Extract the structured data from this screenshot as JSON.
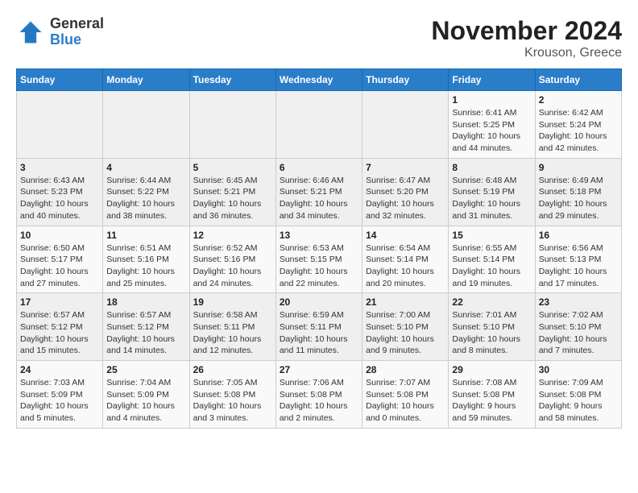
{
  "header": {
    "logo_line1": "General",
    "logo_line2": "Blue",
    "month": "November 2024",
    "location": "Krouson, Greece"
  },
  "weekdays": [
    "Sunday",
    "Monday",
    "Tuesday",
    "Wednesday",
    "Thursday",
    "Friday",
    "Saturday"
  ],
  "weeks": [
    [
      {
        "day": "",
        "info": ""
      },
      {
        "day": "",
        "info": ""
      },
      {
        "day": "",
        "info": ""
      },
      {
        "day": "",
        "info": ""
      },
      {
        "day": "",
        "info": ""
      },
      {
        "day": "1",
        "info": "Sunrise: 6:41 AM\nSunset: 5:25 PM\nDaylight: 10 hours\nand 44 minutes."
      },
      {
        "day": "2",
        "info": "Sunrise: 6:42 AM\nSunset: 5:24 PM\nDaylight: 10 hours\nand 42 minutes."
      }
    ],
    [
      {
        "day": "3",
        "info": "Sunrise: 6:43 AM\nSunset: 5:23 PM\nDaylight: 10 hours\nand 40 minutes."
      },
      {
        "day": "4",
        "info": "Sunrise: 6:44 AM\nSunset: 5:22 PM\nDaylight: 10 hours\nand 38 minutes."
      },
      {
        "day": "5",
        "info": "Sunrise: 6:45 AM\nSunset: 5:21 PM\nDaylight: 10 hours\nand 36 minutes."
      },
      {
        "day": "6",
        "info": "Sunrise: 6:46 AM\nSunset: 5:21 PM\nDaylight: 10 hours\nand 34 minutes."
      },
      {
        "day": "7",
        "info": "Sunrise: 6:47 AM\nSunset: 5:20 PM\nDaylight: 10 hours\nand 32 minutes."
      },
      {
        "day": "8",
        "info": "Sunrise: 6:48 AM\nSunset: 5:19 PM\nDaylight: 10 hours\nand 31 minutes."
      },
      {
        "day": "9",
        "info": "Sunrise: 6:49 AM\nSunset: 5:18 PM\nDaylight: 10 hours\nand 29 minutes."
      }
    ],
    [
      {
        "day": "10",
        "info": "Sunrise: 6:50 AM\nSunset: 5:17 PM\nDaylight: 10 hours\nand 27 minutes."
      },
      {
        "day": "11",
        "info": "Sunrise: 6:51 AM\nSunset: 5:16 PM\nDaylight: 10 hours\nand 25 minutes."
      },
      {
        "day": "12",
        "info": "Sunrise: 6:52 AM\nSunset: 5:16 PM\nDaylight: 10 hours\nand 24 minutes."
      },
      {
        "day": "13",
        "info": "Sunrise: 6:53 AM\nSunset: 5:15 PM\nDaylight: 10 hours\nand 22 minutes."
      },
      {
        "day": "14",
        "info": "Sunrise: 6:54 AM\nSunset: 5:14 PM\nDaylight: 10 hours\nand 20 minutes."
      },
      {
        "day": "15",
        "info": "Sunrise: 6:55 AM\nSunset: 5:14 PM\nDaylight: 10 hours\nand 19 minutes."
      },
      {
        "day": "16",
        "info": "Sunrise: 6:56 AM\nSunset: 5:13 PM\nDaylight: 10 hours\nand 17 minutes."
      }
    ],
    [
      {
        "day": "17",
        "info": "Sunrise: 6:57 AM\nSunset: 5:12 PM\nDaylight: 10 hours\nand 15 minutes."
      },
      {
        "day": "18",
        "info": "Sunrise: 6:57 AM\nSunset: 5:12 PM\nDaylight: 10 hours\nand 14 minutes."
      },
      {
        "day": "19",
        "info": "Sunrise: 6:58 AM\nSunset: 5:11 PM\nDaylight: 10 hours\nand 12 minutes."
      },
      {
        "day": "20",
        "info": "Sunrise: 6:59 AM\nSunset: 5:11 PM\nDaylight: 10 hours\nand 11 minutes."
      },
      {
        "day": "21",
        "info": "Sunrise: 7:00 AM\nSunset: 5:10 PM\nDaylight: 10 hours\nand 9 minutes."
      },
      {
        "day": "22",
        "info": "Sunrise: 7:01 AM\nSunset: 5:10 PM\nDaylight: 10 hours\nand 8 minutes."
      },
      {
        "day": "23",
        "info": "Sunrise: 7:02 AM\nSunset: 5:10 PM\nDaylight: 10 hours\nand 7 minutes."
      }
    ],
    [
      {
        "day": "24",
        "info": "Sunrise: 7:03 AM\nSunset: 5:09 PM\nDaylight: 10 hours\nand 5 minutes."
      },
      {
        "day": "25",
        "info": "Sunrise: 7:04 AM\nSunset: 5:09 PM\nDaylight: 10 hours\nand 4 minutes."
      },
      {
        "day": "26",
        "info": "Sunrise: 7:05 AM\nSunset: 5:08 PM\nDaylight: 10 hours\nand 3 minutes."
      },
      {
        "day": "27",
        "info": "Sunrise: 7:06 AM\nSunset: 5:08 PM\nDaylight: 10 hours\nand 2 minutes."
      },
      {
        "day": "28",
        "info": "Sunrise: 7:07 AM\nSunset: 5:08 PM\nDaylight: 10 hours\nand 0 minutes."
      },
      {
        "day": "29",
        "info": "Sunrise: 7:08 AM\nSunset: 5:08 PM\nDaylight: 9 hours\nand 59 minutes."
      },
      {
        "day": "30",
        "info": "Sunrise: 7:09 AM\nSunset: 5:08 PM\nDaylight: 9 hours\nand 58 minutes."
      }
    ]
  ]
}
